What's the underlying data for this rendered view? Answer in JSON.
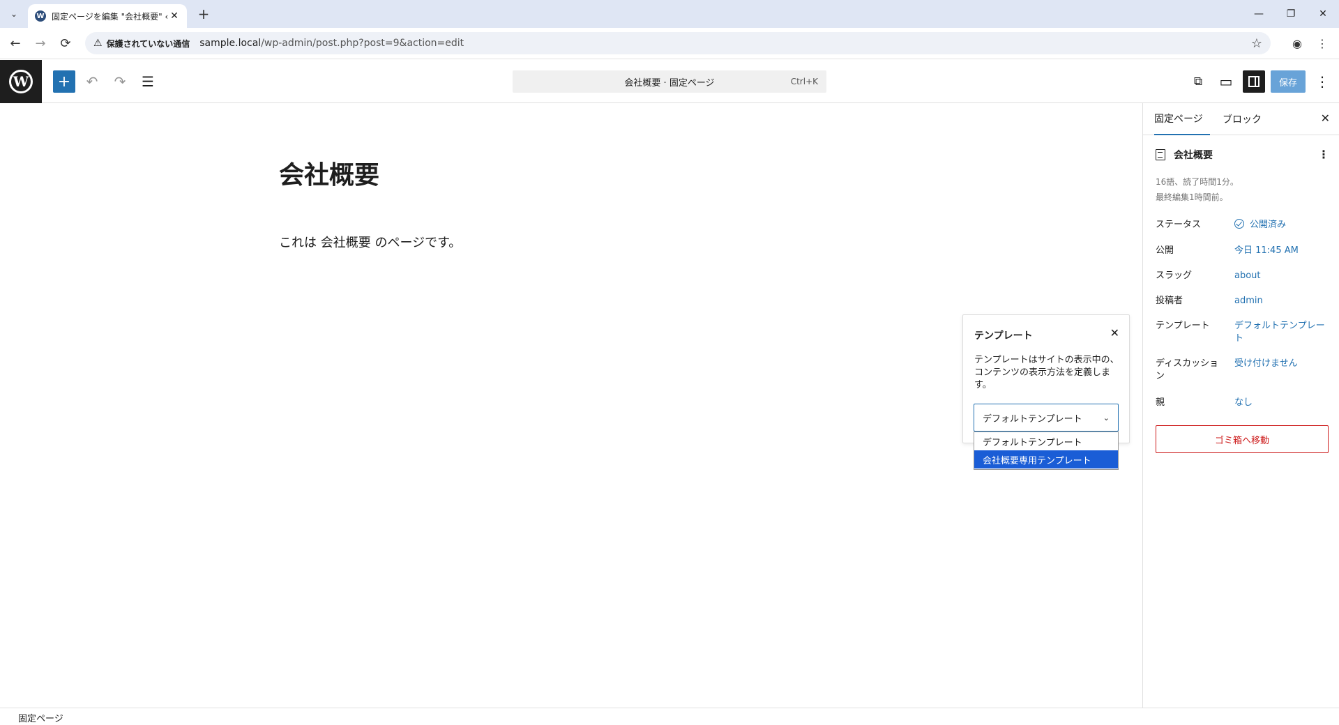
{
  "browser": {
    "tab_title": "固定ページを編集 \"会社概要\" ‹ サ",
    "favicon": "W",
    "tab_close": "✕",
    "new_tab": "+",
    "tab_list": "⌄",
    "window": {
      "minimize": "—",
      "restore": "❐",
      "close": "✕"
    },
    "nav": {
      "back": "←",
      "forward": "→",
      "reload": "⟳"
    },
    "address": {
      "warning_icon": "⚠",
      "insecure_label": "保護されていない通信",
      "host": "sample.local",
      "path": "/wp-admin/post.php?post=9&action=edit",
      "bookmark_icon": "☆"
    },
    "profile_icon": "◉",
    "menu_icon": "⋮"
  },
  "editor_header": {
    "logo_letter": "W",
    "inserter": "+",
    "undo": "↶",
    "redo": "↷",
    "list_view": "☰",
    "command_bar": {
      "text": "会社概要 · 固定ページ",
      "shortcut": "Ctrl+K"
    },
    "view_icon": "⧉",
    "preview_icon": "▭",
    "save_label": "保存",
    "options_icon": "⋮"
  },
  "content": {
    "title": "会社概要",
    "paragraph": "これは 会社概要 のページです。"
  },
  "template_popover": {
    "title": "テンプレート",
    "close": "✕",
    "description": "テンプレートはサイトの表示中の、コンテンツの表示方法を定義します。",
    "selected": "デフォルトテンプレート",
    "chevron": "⌄",
    "options": [
      "デフォルトテンプレート",
      "会社概要専用テンプレート"
    ],
    "highlighted_index": 1
  },
  "sidebar": {
    "tabs": [
      "固定ページ",
      "ブロック"
    ],
    "active_tab": 0,
    "close": "✕",
    "document_title": "会社概要",
    "document_menu": "⋮",
    "meta_line1": "16語、読了時間1分。",
    "meta_line2": "最終編集1時間前。",
    "rows": [
      {
        "label": "ステータス",
        "value": "公開済み"
      },
      {
        "label": "公開",
        "value": "今日 11:45 AM"
      },
      {
        "label": "スラッグ",
        "value": "about"
      },
      {
        "label": "投稿者",
        "value": "admin"
      },
      {
        "label": "テンプレート",
        "value": "デフォルトテンプレート"
      },
      {
        "label": "ディスカッション",
        "value": "受け付けません"
      },
      {
        "label": "親",
        "value": "なし"
      }
    ],
    "trash_label": "ゴミ箱へ移動"
  },
  "footer": {
    "breadcrumb": "固定ページ"
  },
  "colors": {
    "accent": "#2271b1",
    "danger": "#cc1818",
    "selected_option": "#1a5dd6"
  }
}
